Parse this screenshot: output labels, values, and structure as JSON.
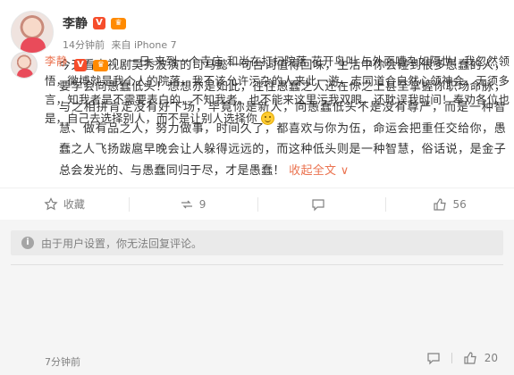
{
  "post": {
    "author": "李静",
    "verified_badge": "V",
    "member_badge": "♛",
    "time": "14分钟前",
    "source": "来自 iPhone 7",
    "text": "今天看电视剧吴秀波演的司马懿一句台词值得回味，生活中你会碰到很多愚蠢的人，要学会向愚蠢低头！想想亦是如此，往往愚蠢之人还在你之上甚至掌握你职场命脉，与之相拼肯定没有好下场，毕竟你是新人，向愚蠢低头不是没有尊严，而是一种智慧、做有品之人，努力做事，时间久了，都喜欢与你为伍，命运会把重任交给你，愚蠢之人飞扬跋扈早晚会让人躲得远远的，而这种低头则是一种智慧，俗话说，是金子总会发光的、与愚蠢同归于尽，才是愚蠢！",
    "expand_label": "收起全文",
    "expand_arrow": "∨"
  },
  "actions": {
    "favorite_label": "收藏",
    "repost_count": "9",
    "comment_count": "",
    "like_count": "56"
  },
  "comments_section": {
    "notice": "由于用户设置，你无法回复评论。",
    "comment": {
      "author": "李静",
      "colon": "：",
      "text": "一日 来到一个寺庙 和尚在打扫院落 花开鸟叫 与外面嘈杂如隔世！我忽然领悟，微博就是我个人的院落，我不该允许污杂的人来此一游，志同道合自然心领神会，无须多言，知我者是不需要表白的，不知我者，也不能来这里污我双眼，还耽误我时间！奉劝各位也是，自己去选择别人，而不是让别人选择你",
      "time": "7分钟前",
      "like_count": "20"
    }
  },
  "colors": {
    "accent": "#eb7350",
    "muted": "#808080",
    "badge_v": "#f64d2b",
    "badge_member": "#ff8a00"
  },
  "icons": [
    "star-icon",
    "repost-icon",
    "comment-icon",
    "like-icon",
    "info-icon",
    "smile-emoji-icon",
    "verified-icon",
    "crown-icon"
  ]
}
